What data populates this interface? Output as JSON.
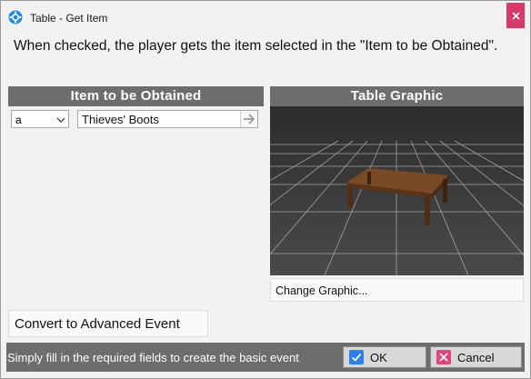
{
  "window": {
    "title": "Table - Get Item"
  },
  "description": "When checked, the player gets the item selected in the \"Item to be Obtained\".",
  "item_panel": {
    "header": "Item to be Obtained",
    "dropdown_value": "a",
    "item_value": "Thieves' Boots"
  },
  "graphic_panel": {
    "header": "Table Graphic",
    "change_label": "Change Graphic..."
  },
  "convert_label": "Convert to Advanced Event",
  "footer": {
    "hint": "Simply fill in the required fields to create the basic event",
    "ok_label": "OK",
    "cancel_label": "Cancel"
  },
  "colors": {
    "header_bg": "#6d6d6d",
    "close_bg": "#d9386a",
    "ok_icon": "#2f7fe8",
    "cancel_icon": "#e0457b",
    "app_icon": "#1e88e5"
  },
  "icons": [
    "app-icon",
    "close-icon",
    "chevron-down-icon",
    "arrow-right-icon",
    "checkmark-icon",
    "x-icon"
  ]
}
